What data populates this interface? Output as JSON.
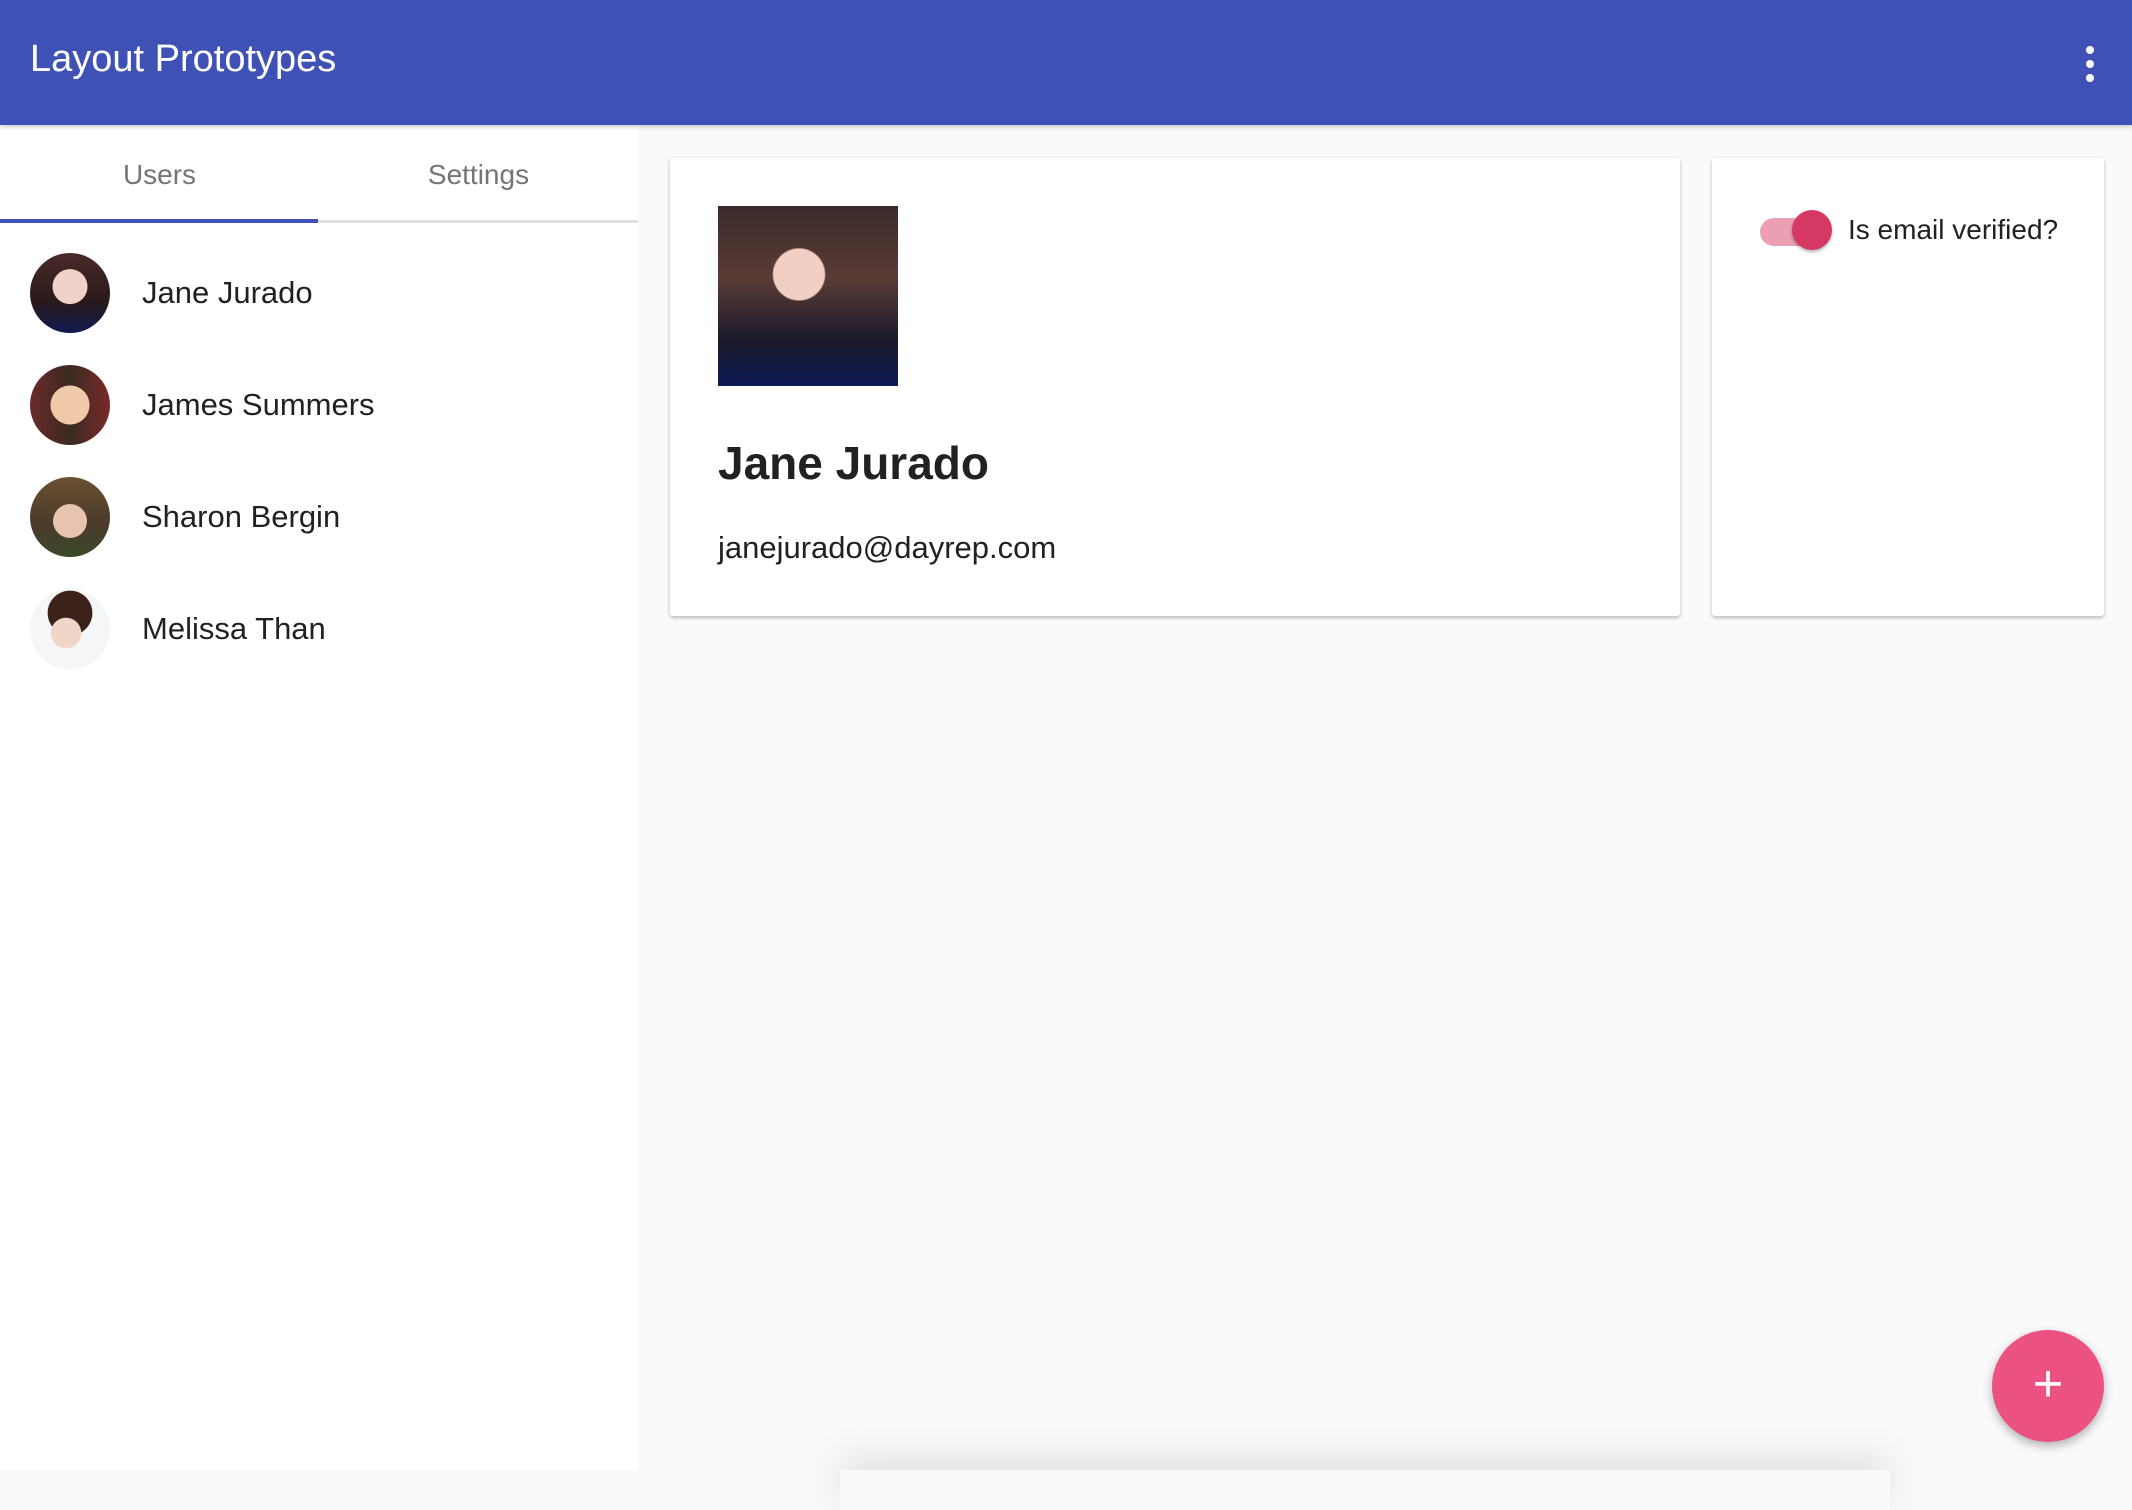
{
  "app": {
    "title": "Layout Prototypes",
    "menu_icon": "more-vert-icon"
  },
  "tabs": [
    {
      "label": "Users",
      "active": true
    },
    {
      "label": "Settings",
      "active": false
    }
  ],
  "users": [
    {
      "name": "Jane Jurado",
      "selected": true
    },
    {
      "name": "James Summers"
    },
    {
      "name": "Sharon Bergin"
    },
    {
      "name": "Melissa Than"
    }
  ],
  "detail": {
    "name": "Jane Jurado",
    "email": "janejurado@dayrep.com"
  },
  "settings": {
    "email_verified_label": "Is email verified?",
    "email_verified": true
  },
  "fab": {
    "icon": "plus-icon",
    "glyph": "+"
  },
  "colors": {
    "primary": "#3f51b5",
    "accent": "#ec5281",
    "toggle": "#d63864"
  }
}
